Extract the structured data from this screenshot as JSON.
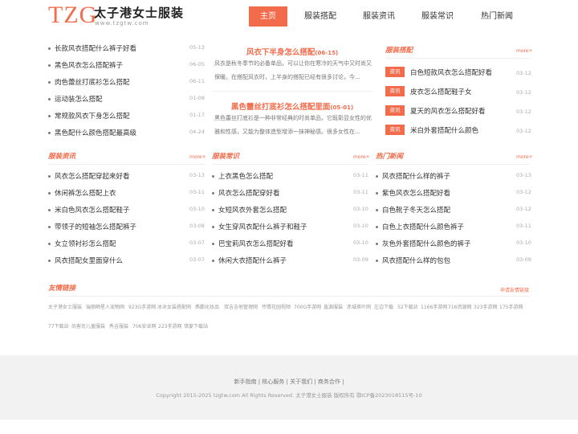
{
  "header": {
    "logo_mark": "TZG",
    "logo_title": "太子港女士服装",
    "logo_domain": "www.tzgtw.com",
    "nav": [
      "主页",
      "服装搭配",
      "服装资讯",
      "服装常识",
      "热门新闻"
    ]
  },
  "top_list": [
    {
      "title": "长款风衣搭配什么裤子好看",
      "date": "05-13"
    },
    {
      "title": "黑色风衣怎么搭配裤子",
      "date": "06-05"
    },
    {
      "title": "肉色蕾丝打底衫怎么搭配",
      "date": "06-11"
    },
    {
      "title": "运动装怎么搭配",
      "date": "01-08"
    },
    {
      "title": "常规款风衣下身怎么搭配",
      "date": "01-17"
    },
    {
      "title": "黑色配什么颜色搭配最高级",
      "date": "04-24"
    }
  ],
  "featured": [
    {
      "title": "风衣下半身怎么搭配",
      "date": "(06-15)",
      "desc": "风衣是秋冬季节的必备单品，可以让你在寒冷的天气中又时尚又保暖。在搭配风衣时，上半身的搭配已经有很多讨论，今..."
    },
    {
      "title": "黑色蕾丝打底衫怎么搭配里面",
      "date": "(05-01)",
      "desc": "黑色蕾丝打底衫是一种非常经典的时尚单品，它既彰显女性的优雅和性感，又能为整体造型增添一抹神秘感。很多女性在..."
    }
  ],
  "dress_match": {
    "title": "服装搭配",
    "more": "more+",
    "badge": "资讯",
    "items": [
      {
        "title": "白色短款风衣怎么搭配好看",
        "date": "03-12"
      },
      {
        "title": "皮衣怎么搭配鞋子女",
        "date": "03-12"
      },
      {
        "title": "夏天的风衣怎么搭配好看",
        "date": "03-12"
      },
      {
        "title": "米白外套搭配什么颜色",
        "date": "03-12"
      }
    ]
  },
  "news": {
    "title": "服装资讯",
    "more": "more+",
    "items": [
      {
        "title": "风衣怎么搭配穿起来好看",
        "date": "03-13"
      },
      {
        "title": "休闲裤怎么搭配上衣",
        "date": "03-11"
      },
      {
        "title": "米白色风衣怎么搭配鞋子",
        "date": "03-10"
      },
      {
        "title": "带领子的短袖怎么搭配裤子",
        "date": "03-08"
      },
      {
        "title": "女立领衬衫怎么搭配",
        "date": "03-07"
      },
      {
        "title": "风衣搭配女里面穿什么",
        "date": "03-07"
      }
    ]
  },
  "tips": {
    "title": "服装常识",
    "more": "more+",
    "items": [
      {
        "title": "上衣黑色怎么搭配",
        "date": "03-11"
      },
      {
        "title": "风衣怎么搭配穿好看",
        "date": "03-11"
      },
      {
        "title": "女短风衣外套怎么搭配",
        "date": "03-10"
      },
      {
        "title": "女生穿风衣配什么裤子和鞋子",
        "date": "03-10"
      },
      {
        "title": "巴宝莉风衣怎么搭配好看",
        "date": "03-10"
      },
      {
        "title": "休闲大衣搭配什么裤子",
        "date": "03-09"
      }
    ]
  },
  "hot": {
    "title": "热门新闻",
    "more": "more+",
    "items": [
      {
        "title": "风衣搭配什么样的裤子",
        "date": "03-13"
      },
      {
        "title": "紫色风衣怎么搭配好看",
        "date": "03-12"
      },
      {
        "title": "白色靴子冬天怎么搭配",
        "date": "03-12"
      },
      {
        "title": "白色上衣搭配什么颜色裤子",
        "date": "03-11"
      },
      {
        "title": "灰色外套搭配什么颜色的裤子",
        "date": "03-10"
      },
      {
        "title": "风衣搭配什么样的包包",
        "date": "03-09"
      }
    ]
  },
  "links": {
    "title": "友情链接",
    "apply": "申请友情链接",
    "row1": [
      "太子港女士服装",
      "瑞丽晒星人宠物网",
      "923G手游网",
      "冰冰女装搭配网",
      "燕鹏化妆品",
      "双吉吉他管理网",
      "传情花园视频",
      "700G手游网",
      "鑫源服装",
      "赤城茶叶网",
      "左边下载",
      "52下载站",
      "1166手游网",
      "716资源网",
      "323手游网",
      "175手游网"
    ],
    "row2": [
      "77下载站",
      "尚客优儿童服装",
      "秀吉服装",
      "706安卓网",
      "223手游网",
      "惜宴下载站"
    ]
  },
  "footer": {
    "links": [
      "新手指南",
      "核心服务",
      "关于我们",
      "商务合作"
    ],
    "copyright": "Copyright 2015-2025 tzgtw.com All Rights Reserved. 太子港女士服装 版权所有 鄂ICP备2023018515号-10"
  }
}
